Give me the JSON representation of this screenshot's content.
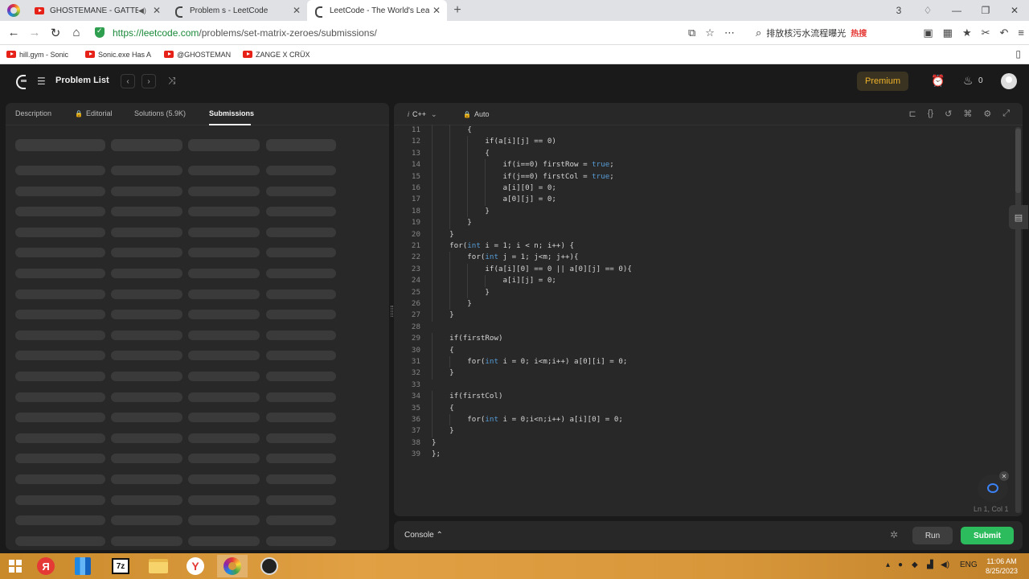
{
  "browser": {
    "tabs": [
      {
        "title": "GHOSTEMANE - GATTEKA",
        "icon": "youtube-icon"
      },
      {
        "title": "Problem s - LeetCode",
        "icon": "leetcode-icon"
      },
      {
        "title": "LeetCode - The World's Leadi",
        "icon": "leetcode-icon"
      }
    ],
    "url_scheme": "https://",
    "url_host": "leetcode.com",
    "url_path": "/problems/set-matrix-zeroes/submissions/",
    "search_text": "排放核污水流程曝光",
    "search_hot": "热搜",
    "tab_count": "3",
    "bookmarks": [
      "hill.gym - Sonic",
      "Sonic.exe Has A",
      "@GHOSTEMAN",
      "ZANGE X CRÜXX"
    ]
  },
  "lc_header": {
    "problem_list": "Problem List",
    "premium": "Premium",
    "fire_count": "0"
  },
  "left_panel": {
    "tabs": [
      "Description",
      "Editorial",
      "Solutions (5.9K)",
      "Submissions"
    ]
  },
  "editor": {
    "language": "C++",
    "mode": "Auto",
    "cursor": "Ln 1, Col 1",
    "lines": [
      {
        "n": "11",
        "t": "        {"
      },
      {
        "n": "12",
        "t": "            if(a[i][j] == 0)"
      },
      {
        "n": "13",
        "t": "            {"
      },
      {
        "n": "14",
        "t": "                if(i==0) firstRow = ",
        "k": "true",
        "e": ";"
      },
      {
        "n": "15",
        "t": "                if(j==0) firstCol = ",
        "k": "true",
        "e": ";"
      },
      {
        "n": "16",
        "t": "                a[i][0] = 0;"
      },
      {
        "n": "17",
        "t": "                a[0][j] = 0;"
      },
      {
        "n": "18",
        "t": "            }"
      },
      {
        "n": "19",
        "t": "        }"
      },
      {
        "n": "20",
        "t": "    }"
      },
      {
        "n": "21",
        "t": "    for(",
        "k": "int",
        "e": " i = 1; i < n; i++) {"
      },
      {
        "n": "22",
        "t": "        for(",
        "k": "int",
        "e": " j = 1; j<m; j++){"
      },
      {
        "n": "23",
        "t": "            if(a[i][0] == 0 || a[0][j] == 0){"
      },
      {
        "n": "24",
        "t": "                a[i][j] = 0;"
      },
      {
        "n": "25",
        "t": "            }"
      },
      {
        "n": "26",
        "t": "        }"
      },
      {
        "n": "27",
        "t": "    }"
      },
      {
        "n": "28",
        "t": ""
      },
      {
        "n": "29",
        "t": "    if(firstRow)"
      },
      {
        "n": "30",
        "t": "    {"
      },
      {
        "n": "31",
        "t": "        for(",
        "k": "int",
        "e": " i = 0; i<m;i++) a[0][i] = 0;"
      },
      {
        "n": "32",
        "t": "    }"
      },
      {
        "n": "33",
        "t": ""
      },
      {
        "n": "34",
        "t": "    if(firstCol)"
      },
      {
        "n": "35",
        "t": "    {"
      },
      {
        "n": "36",
        "t": "        for(",
        "k": "int",
        "e": " i = 0;i<n;i++) a[i][0] = 0;"
      },
      {
        "n": "37",
        "t": "    }"
      },
      {
        "n": "38",
        "t": "}"
      },
      {
        "n": "39",
        "t": "};"
      }
    ]
  },
  "console": {
    "label": "Console",
    "run": "Run",
    "submit": "Submit"
  },
  "taskbar": {
    "lang": "ENG",
    "time": "11:06 AM",
    "date": "8/25/2023"
  }
}
